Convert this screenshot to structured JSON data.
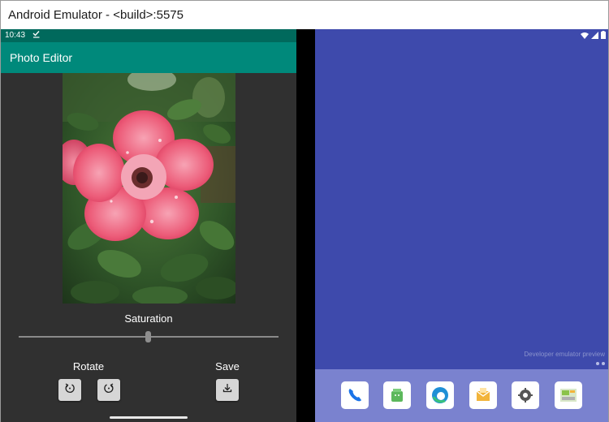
{
  "window": {
    "title": "Android Emulator - <build>:5575"
  },
  "left_screen": {
    "status": {
      "time": "10:43",
      "check_icon": "download-done-icon"
    },
    "app_bar": {
      "title": "Photo Editor"
    },
    "photo": {
      "subject": "pink-rose-photo"
    },
    "saturation": {
      "label": "Saturation",
      "value_fraction": 0.5
    },
    "rotate": {
      "label": "Rotate",
      "left_icon": "rotate-left-icon",
      "right_icon": "rotate-right-icon"
    },
    "save": {
      "label": "Save",
      "icon": "download-icon"
    }
  },
  "right_screen": {
    "status_icons": [
      "wifi-icon",
      "signal-icon",
      "battery-icon"
    ],
    "developer_preview": "Developer emulator preview",
    "dock": [
      {
        "name": "phone-app-icon",
        "color": "#1a73e8"
      },
      {
        "name": "store-app-icon",
        "color": "#5cb85c"
      },
      {
        "name": "edge-browser-icon",
        "color": "#1f8fd6"
      },
      {
        "name": "email-app-icon",
        "color": "#f2b43a"
      },
      {
        "name": "settings-app-icon",
        "color": "#555555"
      },
      {
        "name": "gallery-app-icon",
        "color": "#8bc34a"
      }
    ]
  },
  "colors": {
    "app_bar": "#00897b",
    "status_bar": "#00695c",
    "app_background": "#303030",
    "home_background": "#3e4aac",
    "dock_background": "#7a82cf"
  }
}
